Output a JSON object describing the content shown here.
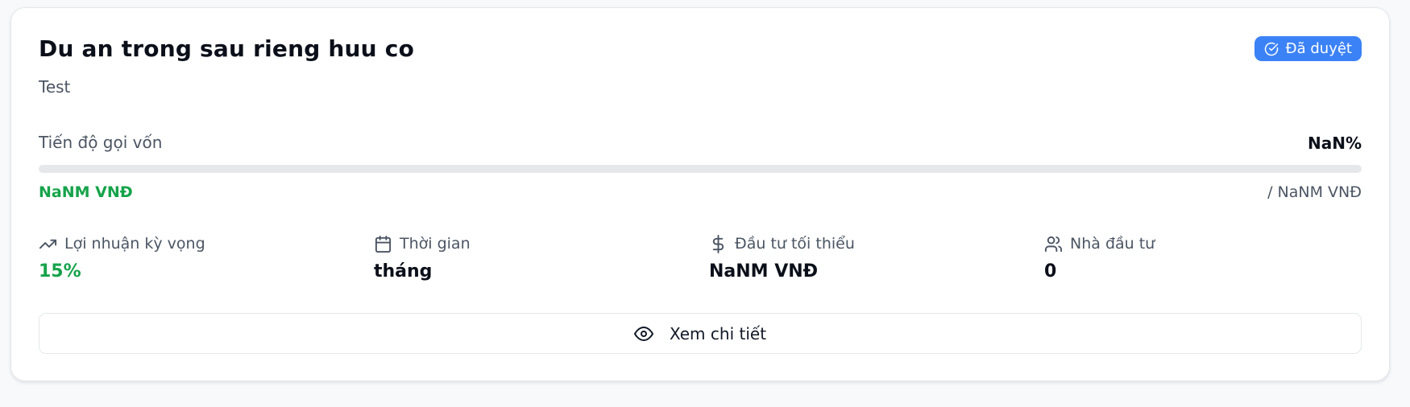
{
  "project": {
    "title": "Du an trong sau rieng huu co",
    "description": "Test",
    "status": {
      "label": "Đã duyệt",
      "icon": "check-circle-icon",
      "color": "#3b82f6"
    }
  },
  "funding": {
    "label": "Tiến độ gọi vốn",
    "percent_text": "NaN%",
    "progress_fraction": 0,
    "raised_text": "NaNM VNĐ",
    "goal_text": "/ NaNM VNĐ",
    "accent_color": "#16a34a"
  },
  "stats": [
    {
      "label": "Lợi nhuận kỳ vọng",
      "value": "15%",
      "icon": "trending-up-icon"
    },
    {
      "label": "Thời gian",
      "value": "tháng",
      "icon": "calendar-icon"
    },
    {
      "label": "Đầu tư tối thiểu",
      "value": "NaNM VNĐ",
      "icon": "dollar-icon"
    },
    {
      "label": "Nhà đầu tư",
      "value": "0",
      "icon": "users-icon"
    }
  ],
  "actions": {
    "view_details_label": "Xem chi tiết",
    "view_details_icon": "eye-icon"
  }
}
